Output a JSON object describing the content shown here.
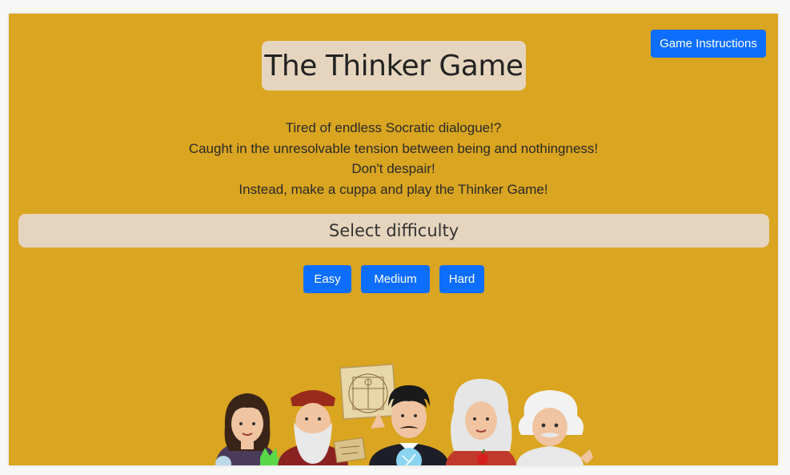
{
  "header": {
    "instructions_label": "Game Instructions",
    "title": "The Thinker Game"
  },
  "intro": {
    "lines": [
      "Tired of endless Socratic dialogue!?",
      "Caught in the unresolvable tension between being and nothingness!",
      "Don't despair!",
      "Instead, make a cuppa and play the Thinker Game!"
    ]
  },
  "difficulty": {
    "heading": "Select difficulty",
    "buttons": [
      "Easy",
      "Medium",
      "Hard"
    ]
  },
  "colors": {
    "background": "#daa520",
    "panel": "#e6d5be",
    "button": "#0d6efd"
  },
  "illustration": {
    "icon": "thinkers-illustration"
  }
}
